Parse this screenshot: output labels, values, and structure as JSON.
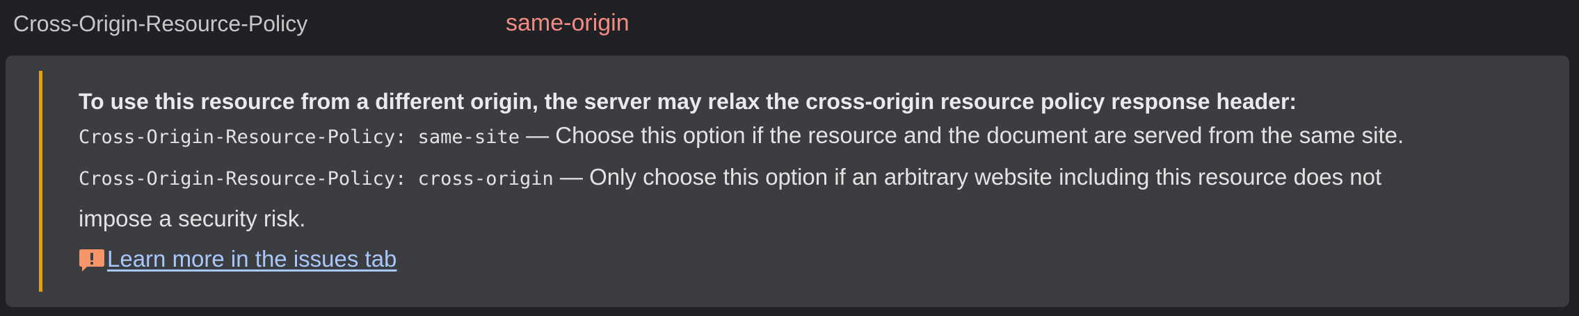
{
  "header": {
    "name": "Cross-Origin-Resource-Policy",
    "value": "same-origin"
  },
  "panel": {
    "heading": "To use this resource from a different origin, the server may relax the cross-origin resource policy response header:",
    "options": [
      {
        "code": "Cross-Origin-Resource-Policy: same-site",
        "description": " — Choose this option if the resource and the document are served from the same site."
      },
      {
        "code": "Cross-Origin-Resource-Policy: cross-origin",
        "description": " — Only choose this option if an arbitrary website including this resource does not",
        "description_continued": "impose a security risk."
      }
    ],
    "link_label": "Learn more in the issues tab",
    "link_icon": "issue-warning-icon"
  },
  "colors": {
    "background": "#202124",
    "panel": "#3c3d41",
    "accent_bar": "#e5a00d",
    "header_value": "#f28b82",
    "link": "#a8c7fa",
    "issue_icon": "#f6946a"
  }
}
